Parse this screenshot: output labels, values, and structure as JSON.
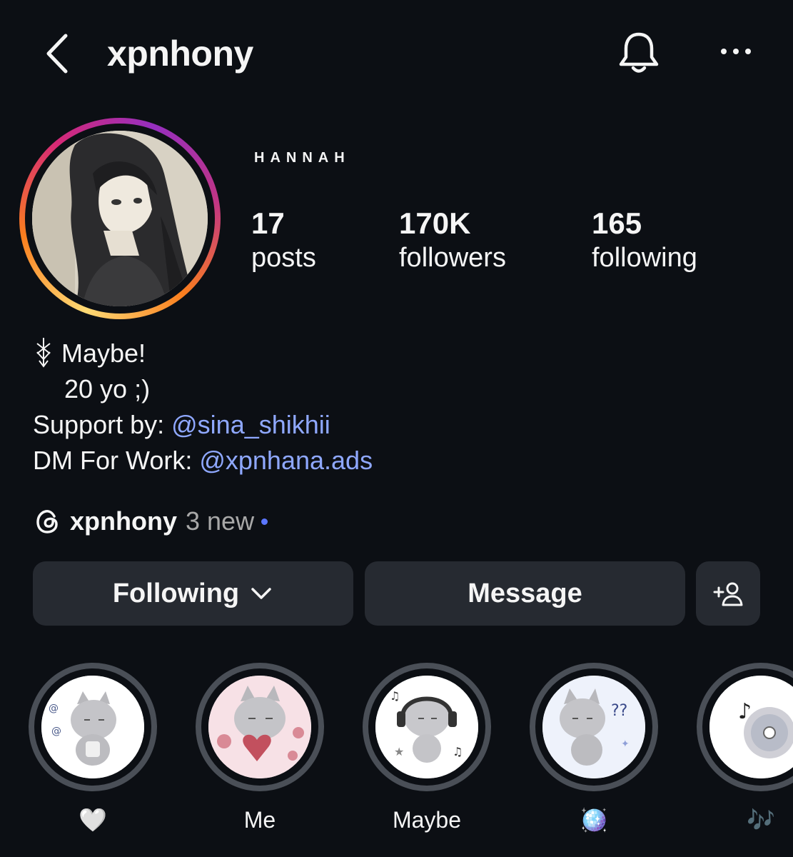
{
  "header": {
    "username": "xpnhony"
  },
  "profile": {
    "display_name": "HANNAH",
    "stats": [
      {
        "value": "17",
        "label": "posts"
      },
      {
        "value": "170K",
        "label": "followers"
      },
      {
        "value": "165",
        "label": "following"
      }
    ],
    "ring_colors": [
      "#feda75",
      "#fa7e1e",
      "#d62976",
      "#962fbf"
    ]
  },
  "bio": {
    "line1": "Maybe!",
    "line2": "20 yo ;)",
    "support_prefix": "Support by: ",
    "support_mention": "@sina_shikhii",
    "work_prefix": "DM For Work: ",
    "work_mention": "@xpnhana.ads",
    "threads_handle": "xpnhony",
    "threads_new": "3 new"
  },
  "actions": {
    "following_label": "Following",
    "message_label": "Message"
  },
  "highlights": [
    {
      "label": "🤍"
    },
    {
      "label": "Me"
    },
    {
      "label": "Maybe"
    },
    {
      "label": "🪩"
    },
    {
      "label": "🎶"
    }
  ],
  "colors": {
    "background": "#0c0f14",
    "button": "#262a31",
    "mention": "#8fa8ff",
    "threads_dot": "#5b76ff"
  }
}
